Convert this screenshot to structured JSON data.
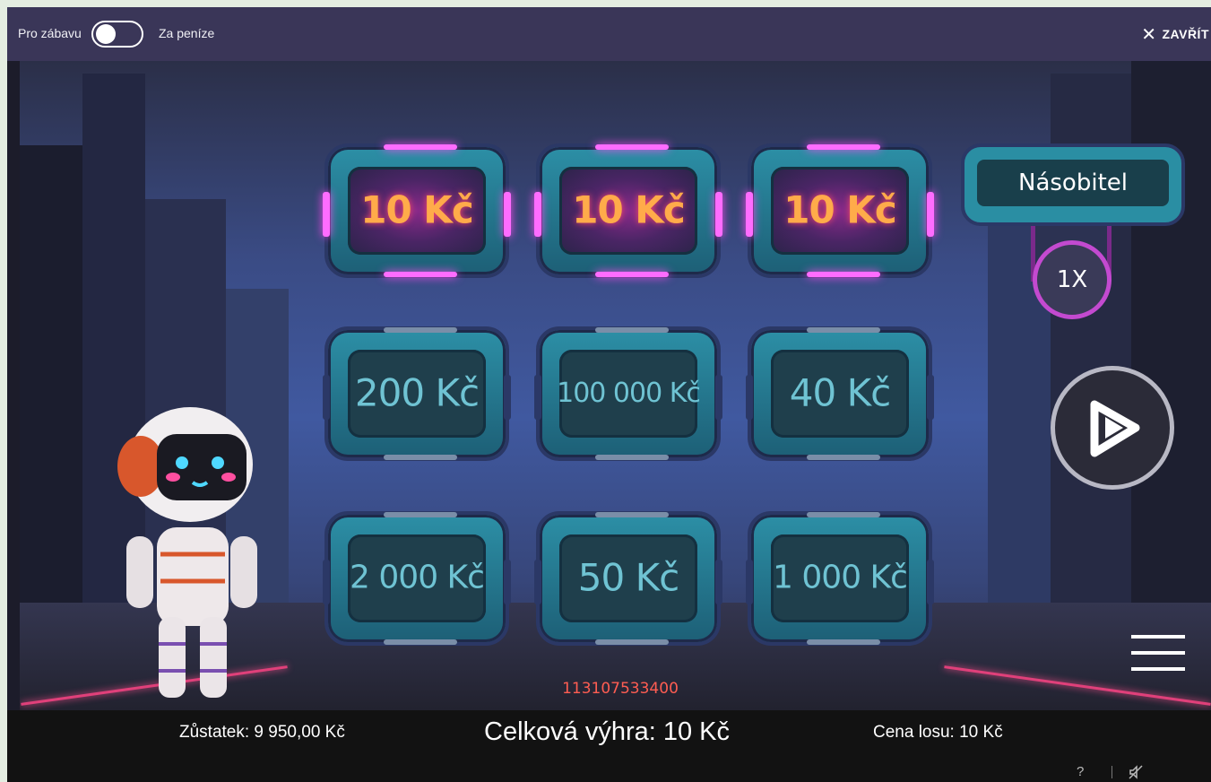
{
  "topbar": {
    "fun_label": "Pro zábavu",
    "money_label": "Za peníze",
    "close_label": "ZAVŘÍT",
    "close_icon": "close-icon"
  },
  "grid": {
    "rows": [
      [
        {
          "value": "10 Kč",
          "won": true
        },
        {
          "value": "10 Kč",
          "won": true
        },
        {
          "value": "10 Kč",
          "won": true
        }
      ],
      [
        {
          "value": "200 Kč",
          "won": false
        },
        {
          "value": "100 000 Kč",
          "won": false
        },
        {
          "value": "40 Kč",
          "won": false
        }
      ],
      [
        {
          "value": "2 000 Kč",
          "won": false
        },
        {
          "value": "50 Kč",
          "won": false
        },
        {
          "value": "1 000 Kč",
          "won": false
        }
      ]
    ]
  },
  "multiplier": {
    "label": "Násobitel",
    "value": "1X"
  },
  "play_icon": "play-icon",
  "menu_icon": "hamburger-menu-icon",
  "serial": "113107533400",
  "bottom": {
    "balance": "Zůstatek: 9 950,00 Kč",
    "total_win": "Celková výhra: 10 Kč",
    "ticket_price": "Cena losu: 10 Kč",
    "help": "?",
    "sound_icon": "sound-muted-icon"
  },
  "colors": {
    "topbar": "#3a3658",
    "won_text": "#ffab4a",
    "tile_text": "#6fc3d3",
    "accent_pink": "#ff6cff",
    "serial": "#ff5d52"
  }
}
